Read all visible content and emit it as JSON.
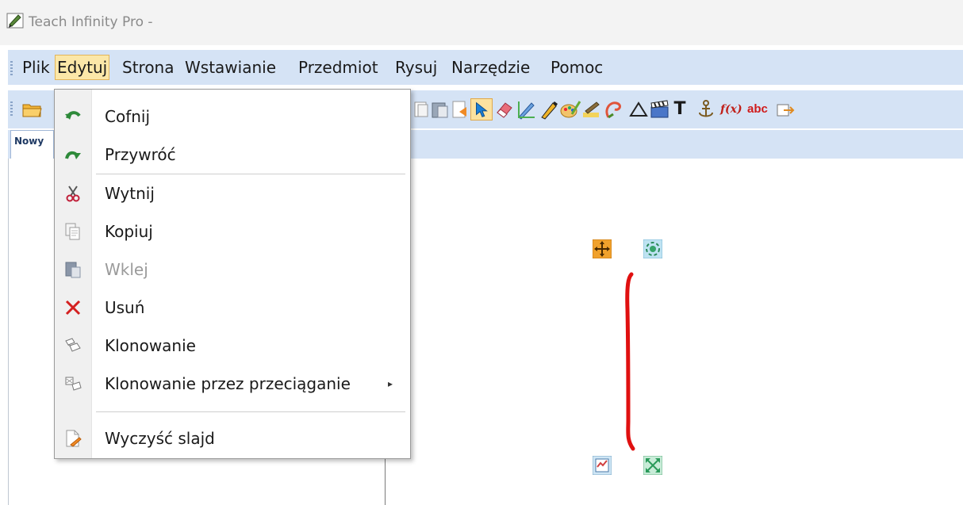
{
  "window": {
    "title": "Teach Infinity Pro -"
  },
  "menubar": {
    "items": [
      {
        "label": "Plik"
      },
      {
        "label": "Edytuj",
        "active": true
      },
      {
        "label": "Strona"
      },
      {
        "label": "Wstawianie"
      },
      {
        "label": "Przedmiot"
      },
      {
        "label": "Rysuj"
      },
      {
        "label": "Narzędzie"
      },
      {
        "label": "Pomoc"
      }
    ]
  },
  "toolbar": {
    "text_buttons": {
      "text_tool": "T",
      "formula_tool": "f(x)",
      "abc_tool": "abc"
    },
    "icons": [
      "open-folder-icon",
      "paste-icon",
      "copy-icon",
      "page-icon",
      "select-arrow-icon",
      "eraser-icon",
      "pen-icon",
      "marker-icon",
      "palette-icon",
      "highlight-icon",
      "shape-icon",
      "triangle-icon",
      "clapperboard-icon",
      "text-icon",
      "anchor-icon",
      "function-icon",
      "abc-icon",
      "export-icon"
    ]
  },
  "tabs": [
    {
      "label": "Nowy"
    }
  ],
  "edit_menu": {
    "items": [
      {
        "label": "Cofnij",
        "icon": "undo-icon",
        "enabled": true
      },
      {
        "label": "Przywróć",
        "icon": "redo-icon",
        "enabled": true
      },
      {
        "label": "Wytnij",
        "icon": "scissors-icon",
        "enabled": true
      },
      {
        "label": "Kopiuj",
        "icon": "copy-icon",
        "enabled": true
      },
      {
        "label": "Wklej",
        "icon": "paste-icon",
        "enabled": false
      },
      {
        "label": "Usuń",
        "icon": "delete-icon",
        "enabled": true
      },
      {
        "label": "Klonowanie",
        "icon": "clone-icon",
        "enabled": true
      },
      {
        "label": "Klonowanie przez przeciąganie",
        "icon": "drag-clone-icon",
        "enabled": true,
        "submenu": true
      },
      {
        "label": "Wyczyść slajd",
        "icon": "clear-slide-icon",
        "enabled": true
      }
    ],
    "submenu_arrow": "▸"
  },
  "colors": {
    "menubar_bg": "#d5e3f5",
    "active_menu_bg": "#fbe7a8",
    "stroke_red": "#e01010"
  }
}
